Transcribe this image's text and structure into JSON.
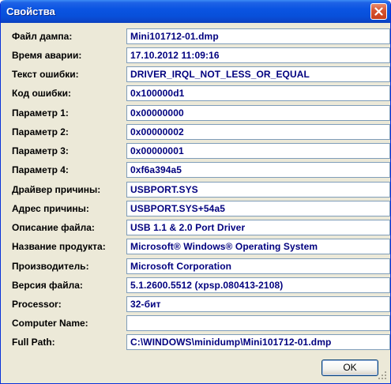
{
  "window": {
    "title": "Свойства"
  },
  "fields": [
    {
      "label": "Файл дампа:",
      "value": "Mini101712-01.dmp"
    },
    {
      "label": "Время аварии:",
      "value": "17.10.2012 11:09:16"
    },
    {
      "label": "Текст ошибки:",
      "value": "DRIVER_IRQL_NOT_LESS_OR_EQUAL"
    },
    {
      "label": "Код ошибки:",
      "value": "0x100000d1"
    },
    {
      "label": "Параметр 1:",
      "value": "0x00000000"
    },
    {
      "label": "Параметр 2:",
      "value": "0x00000002"
    },
    {
      "label": "Параметр 3:",
      "value": "0x00000001"
    },
    {
      "label": "Параметр 4:",
      "value": "0xf6a394a5"
    },
    {
      "label": "Драйвер причины:",
      "value": "USBPORT.SYS"
    },
    {
      "label": "Адрес причины:",
      "value": "USBPORT.SYS+54a5"
    },
    {
      "label": "Описание файла:",
      "value": "USB 1.1 & 2.0 Port Driver"
    },
    {
      "label": "Название продукта:",
      "value": "Microsoft® Windows® Operating System"
    },
    {
      "label": "Производитель:",
      "value": "Microsoft Corporation"
    },
    {
      "label": "Версия файла:",
      "value": "5.1.2600.5512 (xpsp.080413-2108)"
    },
    {
      "label": "Processor:",
      "value": "32-бит"
    },
    {
      "label": "Computer Name:",
      "value": ""
    },
    {
      "label": "Full Path:",
      "value": "C:\\WINDOWS\\minidump\\Mini101712-01.dmp"
    }
  ],
  "buttons": {
    "ok_label": "OK"
  },
  "icons": {
    "close": "close-icon",
    "grip": "resize-grip-icon"
  },
  "colors": {
    "titlebar": "#0A54E2",
    "dialog_bg": "#ECE9D8",
    "value_text": "#00007F",
    "field_border": "#7F9DB9"
  }
}
